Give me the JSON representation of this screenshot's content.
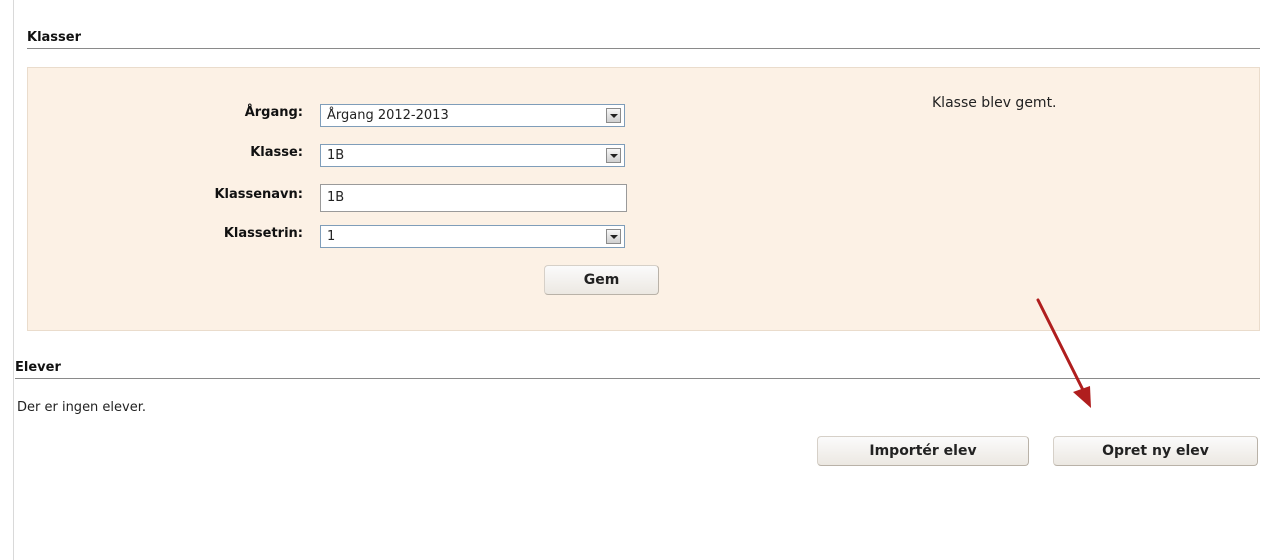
{
  "klasser": {
    "title": "Klasser",
    "form": {
      "aargang_label": "Årgang:",
      "aargang_value": "Årgang 2012-2013",
      "klasse_label": "Klasse:",
      "klasse_value": "1B",
      "klassenavn_label": "Klassenavn:",
      "klassenavn_value": "1B",
      "klassetrin_label": "Klassetrin:",
      "klassetrin_value": "1",
      "save_label": "Gem"
    },
    "message": "Klasse blev gemt."
  },
  "elever": {
    "title": "Elever",
    "empty_text": "Der er ingen elever.",
    "import_label": "Importér elev",
    "create_label": "Opret ny elev"
  },
  "annotation": {
    "arrow_color": "#b01e1e"
  }
}
